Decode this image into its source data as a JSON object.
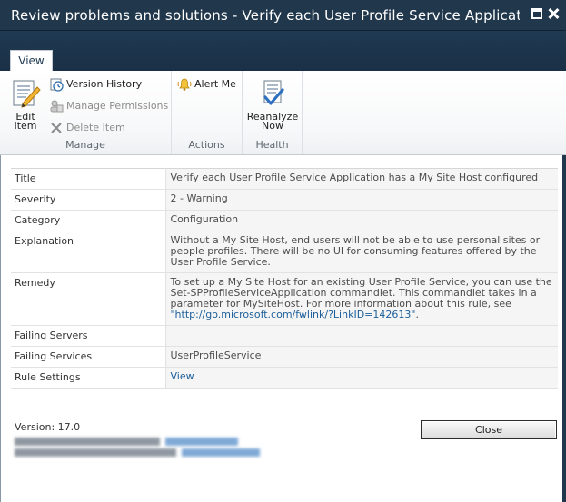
{
  "window": {
    "title": "Review problems and solutions - Verify each User Profile Service Application...",
    "colors": {
      "titlebar": "#21374c",
      "link": "#1a5e9a"
    }
  },
  "ribbon": {
    "tabs": [
      {
        "label": "View",
        "selected": true
      }
    ],
    "groups": {
      "manage": {
        "label": "Manage",
        "edit_item": "Edit Item",
        "edit_item_line1": "Edit",
        "edit_item_line2": "Item",
        "version_history": "Version History",
        "manage_permissions": "Manage Permissions",
        "delete_item": "Delete Item"
      },
      "actions": {
        "label": "Actions",
        "alert_me": "Alert Me"
      },
      "health": {
        "label": "Health",
        "reanalyze_line1": "Reanalyze",
        "reanalyze_line2": "Now"
      }
    }
  },
  "details": {
    "title": {
      "label": "Title",
      "value": "Verify each User Profile Service Application has a My Site Host configured"
    },
    "severity": {
      "label": "Severity",
      "value": "2 - Warning"
    },
    "category": {
      "label": "Category",
      "value": "Configuration"
    },
    "explanation": {
      "label": "Explanation",
      "value": "Without a My Site Host, end users will not be able to use personal sites or people profiles. There will be no UI for consuming features offered by the User Profile Service."
    },
    "remedy": {
      "label": "Remedy",
      "value": "To set up a My Site Host for an existing User Profile Service, you can use the Set-SPProfileServiceApplication commandlet. This commandlet takes in a parameter for MySiteHost. For more information about this rule, see ",
      "link": "\"http://go.microsoft.com/fwlink/?LinkID=142613\"",
      "suffix": "."
    },
    "failing_servers": {
      "label": "Failing Servers",
      "value": ""
    },
    "failing_services": {
      "label": "Failing Services",
      "value": "UserProfileService"
    },
    "rule_settings": {
      "label": "Rule Settings",
      "value": "View"
    }
  },
  "footer": {
    "version": "Version: 17.0",
    "close_label": "Close"
  }
}
